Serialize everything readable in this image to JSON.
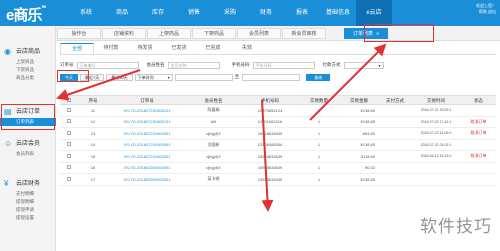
{
  "brand": {
    "logo": "e商乐",
    "sup": "TM"
  },
  "nav": [
    {
      "label": "系统"
    },
    {
      "label": "商品"
    },
    {
      "label": "库存"
    },
    {
      "label": "销售"
    },
    {
      "label": "采购"
    },
    {
      "label": "财务"
    },
    {
      "label": "报表"
    },
    {
      "label": "基础信息"
    },
    {
      "label": "e云店"
    }
  ],
  "user": {
    "line1": "欢迎上您！",
    "line2": "帮助  退出"
  },
  "subtabs": [
    {
      "label": "操作台"
    },
    {
      "label": "店铺资料"
    },
    {
      "label": "上架商品"
    },
    {
      "label": "下架商品"
    },
    {
      "label": "会员列表"
    },
    {
      "label": "新会员审核"
    },
    {
      "label": "订单列表"
    }
  ],
  "sidebar": [
    {
      "title": "云店商品",
      "items": [
        "上架商品",
        "下架商品",
        "商品分类"
      ]
    },
    {
      "title": "云店订单",
      "items": [
        "订单列表"
      ]
    },
    {
      "title": "云店会员",
      "items": [
        "会员列表"
      ]
    },
    {
      "title": "云店财务",
      "items": [
        "支付明细",
        "提现明细",
        "提现申请",
        "提现设置"
      ]
    }
  ],
  "status_tabs": [
    "全部",
    "待付款",
    "待发货",
    "已发货",
    "已完成",
    "失效"
  ],
  "filters": {
    "order_no_label": "订单号",
    "order_no_placeholder": "订单编号",
    "member_label": "会员姓名",
    "member_placeholder": "会员名称",
    "phone_label": "手机号码",
    "phone_placeholder": "手机号码",
    "pay_label": "付款方式",
    "pay_value": "",
    "date_buttons": [
      "今天",
      "最近7天",
      "最近30天"
    ],
    "date_start": "下单时间",
    "date_to": "至",
    "search_label": "查询"
  },
  "table": {
    "headers": [
      "",
      "序号",
      "订单号",
      "会员姓名",
      "手机号码",
      "交易数量",
      "交易金额",
      "支付方式",
      "交易时间",
      "状态"
    ],
    "rows": [
      {
        "idx": "11",
        "order": "XS-YD-201607231000101",
        "name": "陈嘉娟",
        "phone": "15873654124",
        "qty": "1",
        "amount": "¥138.80",
        "pay": "",
        "time": "2016-07-21 15:00:1",
        "status": ""
      },
      {
        "idx": "12",
        "order": "XS-YD-201607231000101",
        "name": "AN",
        "phone": "12701652216",
        "qty": "1",
        "amount": "¥138.80",
        "pay": "",
        "time": "2016-07-23 17:42:1",
        "status": "取消订单"
      },
      {
        "idx": "13",
        "order": "XS-YD-201607231000001",
        "name": "cjfq(yf)3",
        "phone": "15918634549",
        "qty": "1",
        "amount": "¥54.80",
        "pay": "",
        "time": "2016-07-23 14:00:0",
        "status": "取消订单"
      },
      {
        "idx": "14",
        "order": "XS-YD-201607231000001",
        "name": "沈国新",
        "phone": "13126088354",
        "qty": "1",
        "amount": "¥138.80",
        "pay": "",
        "time": "2016-07-21 01:02:1",
        "status": ""
      },
      {
        "idx": "15",
        "order": "XS-YD-201607231000001",
        "name": "cjfq(yf)3",
        "phone": "15918634549",
        "qty": "1",
        "amount": "¥115.60",
        "pay": "",
        "time": "2016-06-12 16:13:0",
        "status": "取消订单"
      },
      {
        "idx": "16",
        "order": "XS-YD-201603300000001",
        "name": "cjfq(yf)3",
        "phone": "15918634549",
        "qty": "1",
        "amount": "¥0.02",
        "pay": "",
        "time": "",
        "status": ""
      },
      {
        "idx": "17",
        "order": "XS-YD-201603300000001",
        "name": "某卡顿",
        "phone": "15918634549",
        "qty": "1",
        "amount": "¥138.80",
        "pay": "",
        "time": "",
        "status": ""
      }
    ]
  },
  "watermark": "软件技巧",
  "colors": {
    "primary": "#1a8fd8",
    "highlight": "#e03232"
  }
}
